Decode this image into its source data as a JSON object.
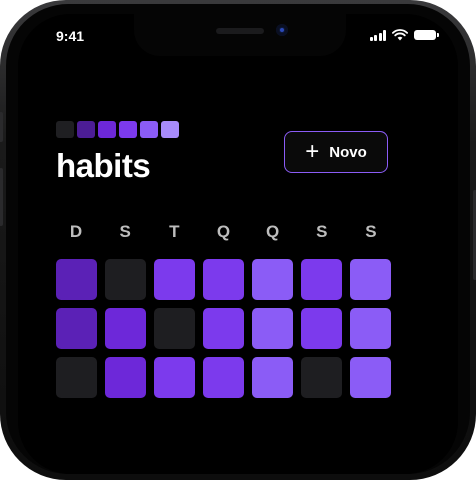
{
  "status_bar": {
    "time": "9:41"
  },
  "header": {
    "title": "habits",
    "logo_colors": [
      "#1f1f22",
      "#4c1d95",
      "#6d28d9",
      "#7c3aed",
      "#8b5cf6",
      "#a78bfa"
    ],
    "new_button": {
      "icon": "plus-icon",
      "label": "Novo",
      "border_color": "#8b5cf6"
    }
  },
  "weekdays": [
    "D",
    "S",
    "T",
    "Q",
    "Q",
    "S",
    "S"
  ],
  "intensity_colors": [
    "#1e1e21",
    "#4c1d95",
    "#5b21b6",
    "#6d28d9",
    "#7c3aed",
    "#8b5cf6"
  ],
  "heatmap": [
    [
      2,
      0,
      4,
      4,
      5,
      4,
      5
    ],
    [
      2,
      3,
      0,
      4,
      5,
      4,
      5
    ],
    [
      0,
      3,
      4,
      4,
      5,
      0,
      5
    ]
  ]
}
